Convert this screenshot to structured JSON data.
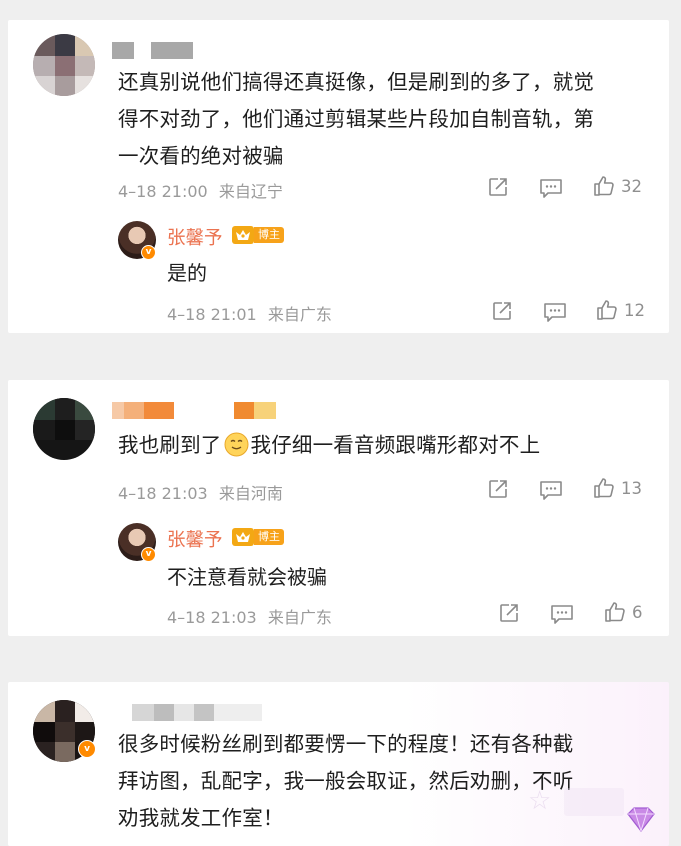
{
  "comments": [
    {
      "text_lines": [
        "还真别说他们搞得还真挺像，但是刷到的多了，就觉",
        "得不对劲了，他们通过剪辑某些片段加自制音轨，第",
        "一次看的绝对被骗"
      ],
      "time": "4–18 21:00",
      "location": "来自辽宁",
      "likes": "32",
      "reply": {
        "author": "张馨予",
        "badge": "博主",
        "text": "是的",
        "time": "4–18 21:01",
        "location": "来自广东",
        "likes": "12"
      }
    },
    {
      "text_before_emoji": "我也刷到了",
      "emoji": "smiling-face-emoji",
      "text_after_emoji": "我仔细一看音频跟嘴形都对不上",
      "time": "4–18 21:03",
      "location": "来自河南",
      "likes": "13",
      "reply": {
        "author": "张馨予",
        "badge": "博主",
        "text": "不注意看就会被骗",
        "time": "4–18 21:03",
        "location": "来自广东",
        "likes": "6"
      }
    },
    {
      "text_lines": [
        "很多时候粉丝刷到都要愣一下的程度！还有各种截",
        "拜访图，乱配字，我一般会取证，然后劝删，不听",
        "劝我就发工作室！"
      ]
    }
  ],
  "icons": [
    "share-icon",
    "comment-icon",
    "like-icon"
  ],
  "colors": {
    "background": "#efefef",
    "card": "#ffffff",
    "author_name": "#eb7350",
    "badge": "#f7a21a",
    "meta_text": "#9a9a9a"
  }
}
